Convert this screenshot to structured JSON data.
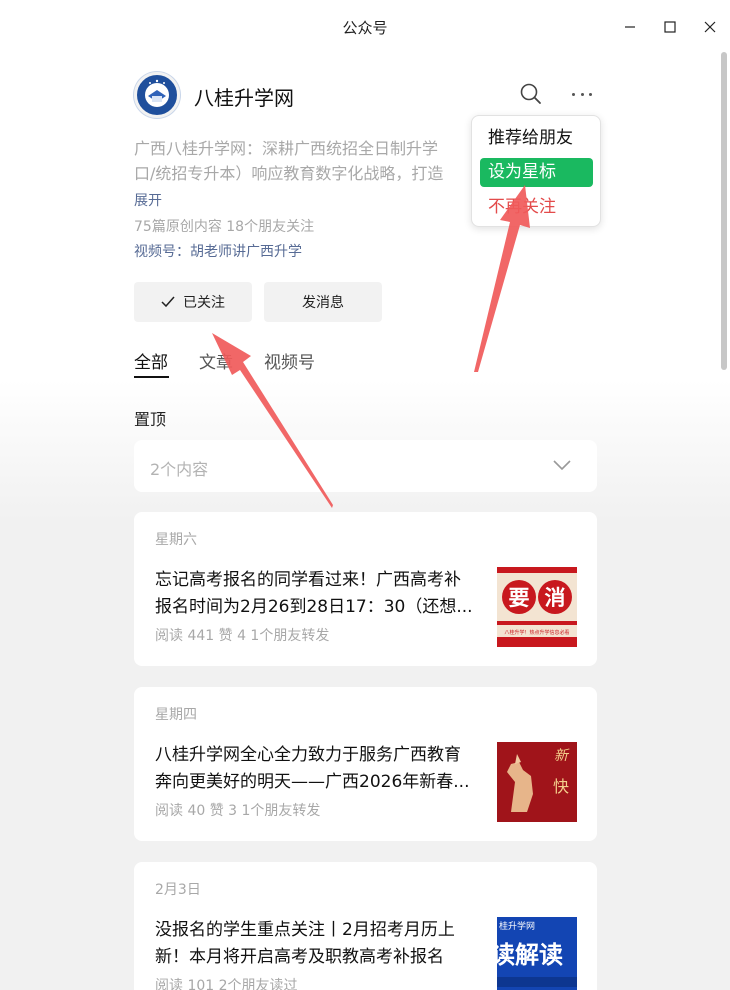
{
  "window": {
    "title": "公众号"
  },
  "account": {
    "name": "八桂升学网",
    "description_lines": [
      "广西八桂升学网：深耕广西统招全日制升学",
      "口/统招专升本）响应教育数字化战略，打造"
    ],
    "expand_label": "展开",
    "stats": "75篇原创内容  18个朋友关注",
    "video_channel": "视频号：胡老师讲广西升学"
  },
  "actions": {
    "followed_label": "已关注",
    "message_label": "发消息"
  },
  "tabs": [
    {
      "label": "全部",
      "active": true
    },
    {
      "label": "文章",
      "active": false
    },
    {
      "label": "视频号",
      "active": false
    }
  ],
  "pinned": {
    "label": "置顶",
    "count_label": "2个内容"
  },
  "menu": {
    "items": [
      {
        "label": "推荐给朋友",
        "highlighted": false
      },
      {
        "label": "设为星标",
        "highlighted": true
      },
      {
        "label": "不再关注",
        "highlighted": false
      }
    ]
  },
  "articles": [
    {
      "date": "星期六",
      "title_line1": "忘记高考报名的同学看过来！广西高考补",
      "title_line2": "报名时间为2月26到28日17：30（还想...",
      "meta": "阅读 441  赞 4  1个朋友转发",
      "thumb_text": "要消",
      "thumb_subtext": "八桂升学！热点升学信息必看"
    },
    {
      "date": "星期四",
      "title_line1": "八桂升学网全心全力致力于服务广西教育",
      "title_line2": "奔向更美好的明天——广西2026年新春...",
      "meta": "阅读 40  赞 3  1个朋友转发",
      "thumb_text": "新",
      "thumb_subtext": "快"
    },
    {
      "date": "2月3日",
      "title_line1": "没报名的学生重点关注丨2月招考月历上",
      "title_line2": "新！本月将开启高考及职教高考补报名",
      "meta": "阅读 101  2个朋友读过",
      "thumb_text": "读解读",
      "thumb_subtext": "桂升学网"
    }
  ],
  "colors": {
    "accent_green": "#1ab960",
    "link_blue": "#576b95",
    "danger_red": "#e34b4b",
    "annotation_arrow": "#f05a5a"
  }
}
